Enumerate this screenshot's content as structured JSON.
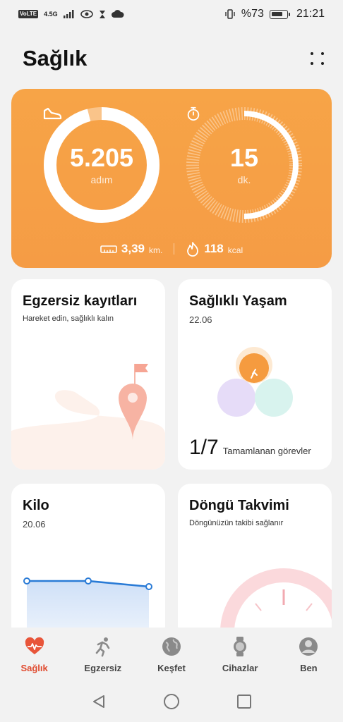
{
  "status_bar": {
    "left_badges": [
      "VoLTE",
      "4.5G"
    ],
    "battery_text": "%73",
    "time": "21:21"
  },
  "header": {
    "title": "Sağlık"
  },
  "activity": {
    "steps_value": "5.205",
    "steps_unit": "adım",
    "steps_progress": 0.96,
    "minutes_value": "15",
    "minutes_unit": "dk.",
    "minutes_progress": 0.5,
    "distance_value": "3,39",
    "distance_unit": "km.",
    "calories_value": "118",
    "calories_unit": "kcal"
  },
  "cards": {
    "exercise": {
      "title": "Egzersiz kayıtları",
      "subtitle": "Hareket edin, sağlıklı kalın"
    },
    "healthy_living": {
      "title": "Sağlıklı Yaşam",
      "date": "22.06",
      "tasks_count": "1/7",
      "tasks_label": "Tamamlanan görevler"
    },
    "weight": {
      "title": "Kilo",
      "date": "20.06"
    },
    "cycle": {
      "title": "Döngü Takvimi",
      "subtitle": "Döngünüzün takibi sağlanır"
    }
  },
  "bottom_nav": {
    "items": [
      {
        "label": "Sağlık",
        "icon": "heart-icon",
        "active": true
      },
      {
        "label": "Egzersiz",
        "icon": "runner-icon",
        "active": false
      },
      {
        "label": "Keşfet",
        "icon": "globe-icon",
        "active": false
      },
      {
        "label": "Cihazlar",
        "icon": "watch-icon",
        "active": false
      },
      {
        "label": "Ben",
        "icon": "profile-icon",
        "active": false
      }
    ]
  },
  "colors": {
    "accent": "#f6a04a",
    "active_nav": "#e04a2e"
  }
}
